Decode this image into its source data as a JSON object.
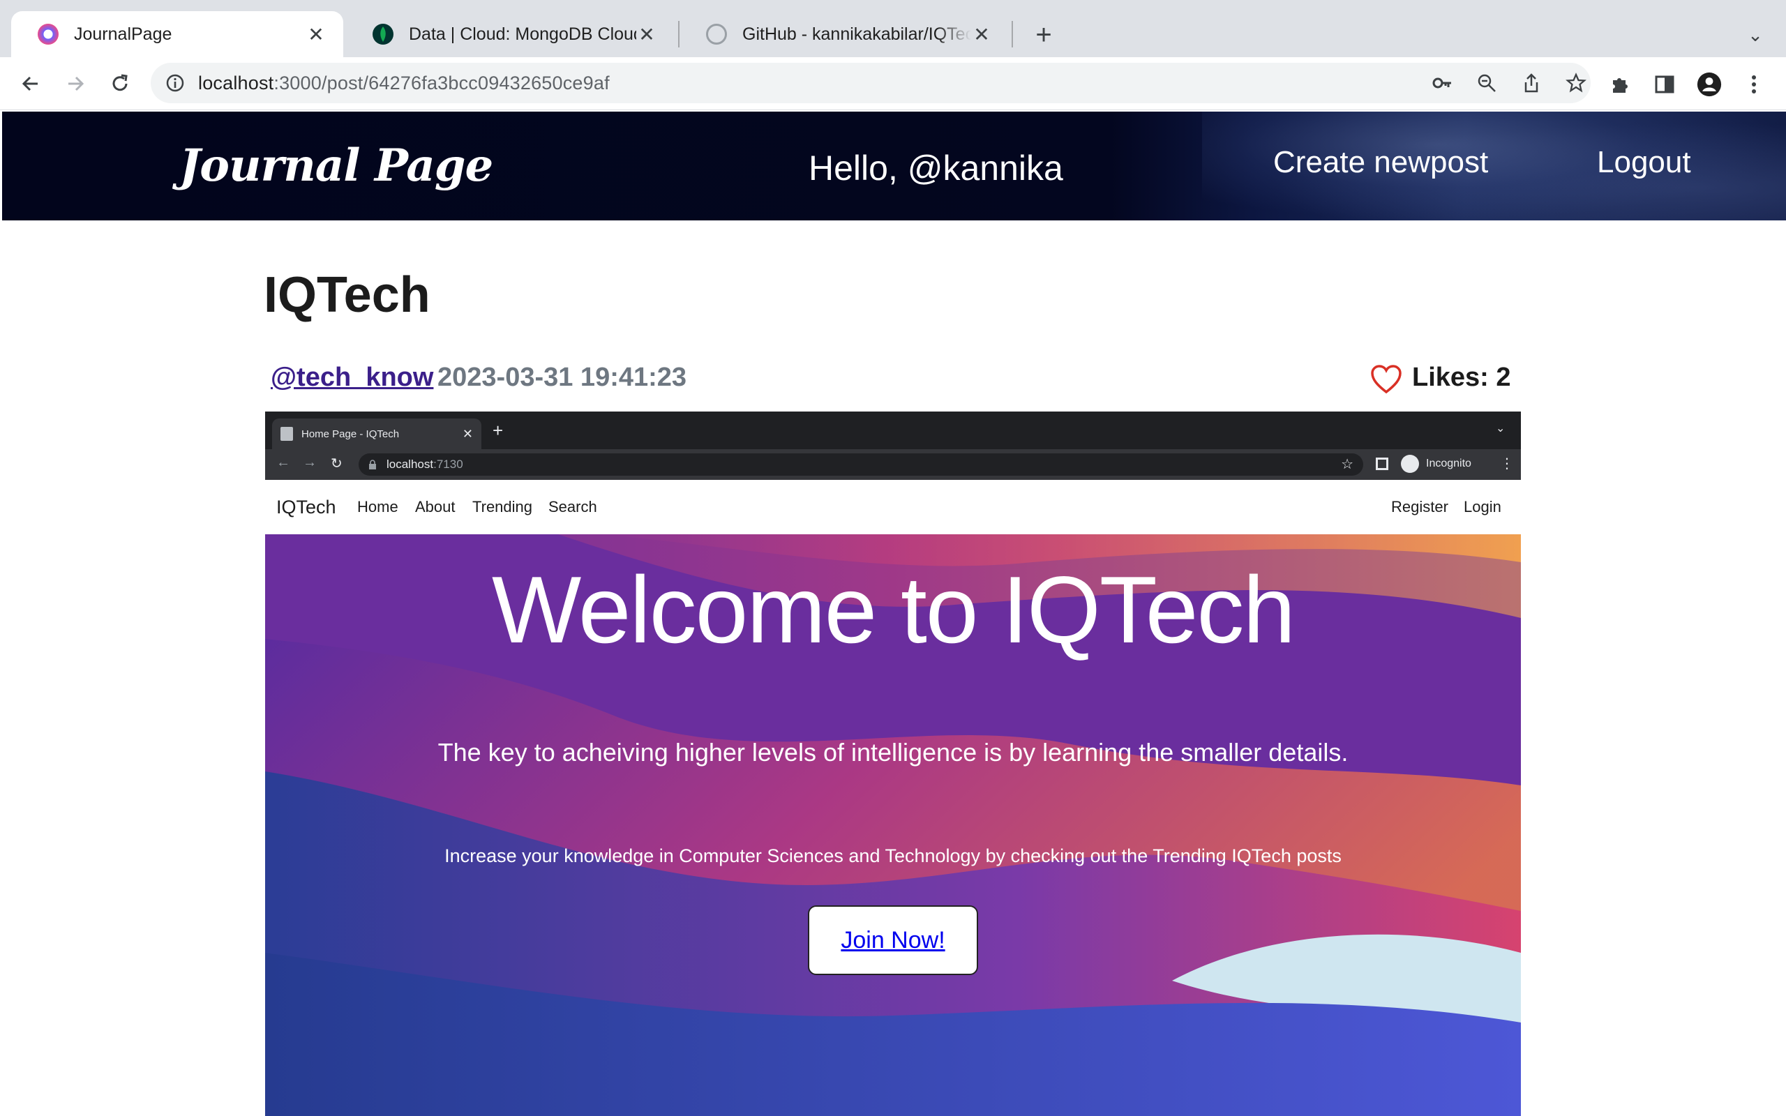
{
  "browser": {
    "tabs": [
      {
        "title": "JournalPage",
        "active": true
      },
      {
        "title": "Data | Cloud: MongoDB Cloud",
        "active": false
      },
      {
        "title": "GitHub - kannikakabilar/IQTech",
        "active": false
      }
    ],
    "url_host": "localhost",
    "url_rest": ":3000/post/64276fa3bcc09432650ce9af"
  },
  "journal": {
    "logo": "Journal Page",
    "greeting": "Hello, @kannika",
    "create_label": "Create newpost",
    "logout_label": "Logout"
  },
  "post": {
    "title": "IQTech",
    "author": "@tech_know",
    "date": "2023-03-31 19:41:23",
    "likes_label": "Likes: 2"
  },
  "screenshot": {
    "tab_title": "Home Page - IQTech",
    "url_host": "localhost",
    "url_port": ":7130",
    "incognito": "Incognito",
    "nav": {
      "brand": "IQTech",
      "links": [
        "Home",
        "About",
        "Trending",
        "Search"
      ],
      "register": "Register",
      "login": "Login"
    },
    "hero": {
      "title": "Welcome to IQTech",
      "subtitle": "The key to acheiving higher levels of intelligence is by learning the smaller details.",
      "body": "Increase your knowledge in Computer Sciences and Technology by checking out the Trending IQTech posts",
      "button": "Join Now!"
    }
  },
  "colors": {
    "header_bg": "#02051c",
    "author_link": "#3b1f8a",
    "heart": "#d93025"
  }
}
